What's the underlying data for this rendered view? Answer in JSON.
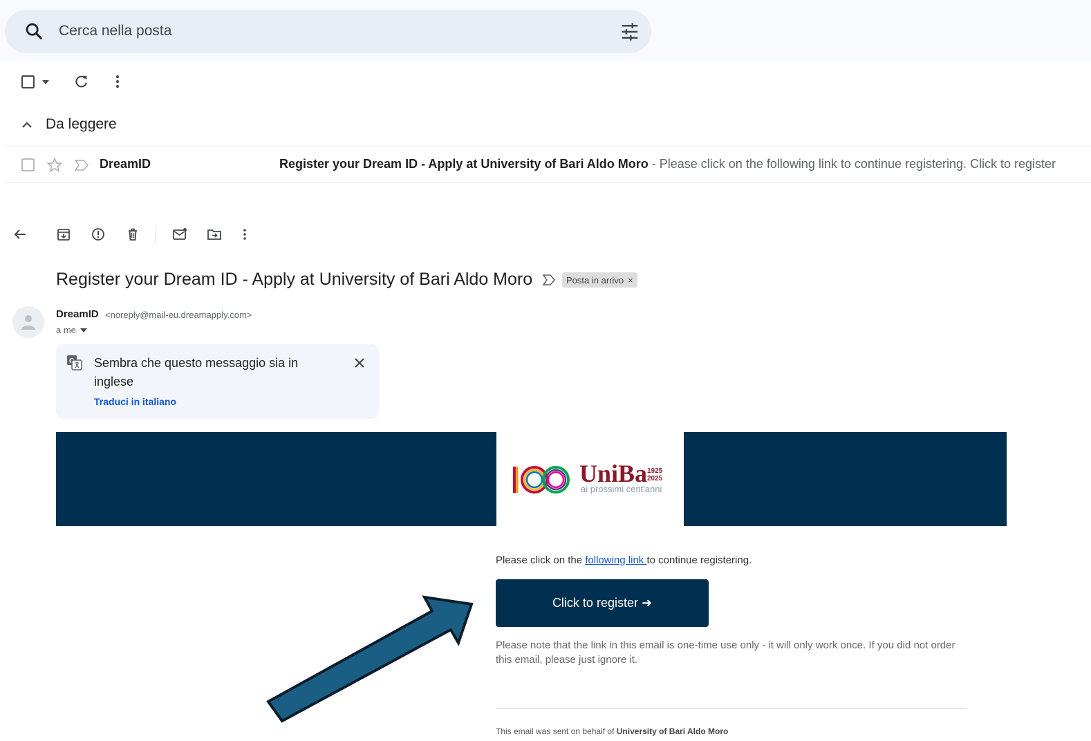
{
  "search": {
    "placeholder": "Cerca nella posta"
  },
  "list": {
    "section_title": "Da leggere",
    "rows": [
      {
        "sender": "DreamID",
        "subject": "Register your Dream ID - Apply at University of Bari Aldo Moro",
        "snippet": " - Please click on the following link to continue registering. Click to register"
      }
    ]
  },
  "message": {
    "title": "Register your Dream ID - Apply at University of Bari Aldo Moro",
    "label": "Posta in arrivo",
    "label_close": "×",
    "from_name": "DreamID",
    "from_email": "<noreply@mail-eu.dreamapply.com>",
    "to": "a me",
    "translate": {
      "text": "Sembra che questo messaggio sia in inglese",
      "link": "Traduci in italiano"
    }
  },
  "email_body": {
    "logo_text": "UniBa",
    "logo_year_1": "1925",
    "logo_year_2": "2025",
    "logo_subtitle": "ai prossimi cent'anni",
    "intro_before": "Please click on the ",
    "intro_link": "following link ",
    "intro_after": "to continue registering.",
    "cta_label": "Click to register ➜",
    "note": "Please note that the link in this email is one-time use only - it will only work once. If you did not order this email, please just ignore it.",
    "footer_prefix": "This email was sent on behalf of ",
    "footer_org": "University of Bari Aldo Moro"
  },
  "colors": {
    "brand_navy": "#003050",
    "search_bg": "#e9eef6",
    "link_blue": "#1155cc",
    "annotation_arrow": "#1b5e84"
  }
}
